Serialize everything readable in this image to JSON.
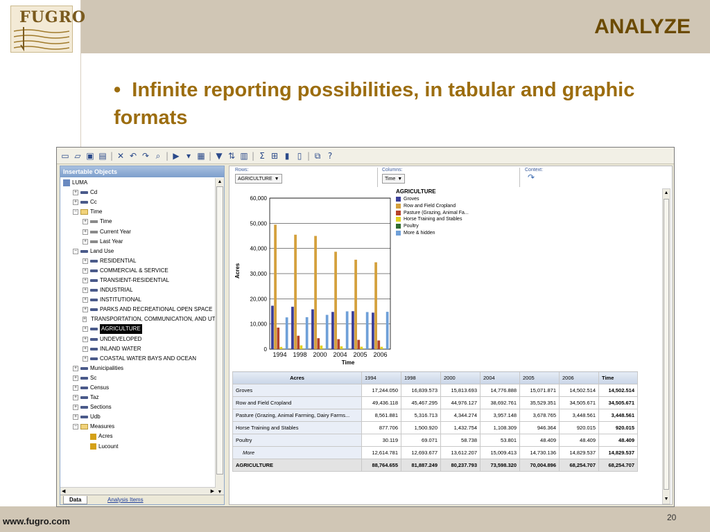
{
  "slide": {
    "brand": "FUGRO",
    "title": "ANALYZE",
    "bullet": "Infinite reporting possibilities, in tabular and graphic formats",
    "footer_url": "www.fugro.com",
    "page_number": "20",
    "colors": {
      "band": "#d0c6b5",
      "title": "#6b4a00",
      "bullet": "#9c6d0f"
    }
  },
  "toolbar": {
    "icons": [
      "new-icon",
      "open-icon",
      "save-icon",
      "save-as-icon",
      "cut-icon",
      "undo-icon",
      "redo-icon",
      "find-icon",
      "run-icon",
      "dropdown-icon",
      "table-view-icon",
      "filter-icon",
      "sort-icon",
      "layout-icon",
      "totals-icon",
      "export-icon",
      "chart-icon",
      "chart-type-icon",
      "window-icon",
      "help-icon"
    ]
  },
  "panel": {
    "title": "Insertable Objects",
    "tree": [
      {
        "level": 0,
        "exp": "",
        "icon": "cube",
        "label": "LUMA"
      },
      {
        "level": 1,
        "exp": "+",
        "icon": "dim",
        "label": "Cd"
      },
      {
        "level": 1,
        "exp": "+",
        "icon": "dim",
        "label": "Cc"
      },
      {
        "level": 1,
        "exp": "−",
        "icon": "fold",
        "label": "Time"
      },
      {
        "level": 2,
        "exp": "+",
        "icon": "lvl",
        "label": "Time"
      },
      {
        "level": 2,
        "exp": "+",
        "icon": "lvl",
        "label": "Current Year"
      },
      {
        "level": 2,
        "exp": "+",
        "icon": "lvl",
        "label": "Last Year"
      },
      {
        "level": 1,
        "exp": "−",
        "icon": "dim",
        "label": "Land Use"
      },
      {
        "level": 2,
        "exp": "+",
        "icon": "dim",
        "label": "RESIDENTIAL"
      },
      {
        "level": 2,
        "exp": "+",
        "icon": "dim",
        "label": "COMMERCIAL & SERVICE"
      },
      {
        "level": 2,
        "exp": "+",
        "icon": "dim",
        "label": "TRANSIENT-RESIDENTIAL"
      },
      {
        "level": 2,
        "exp": "+",
        "icon": "dim",
        "label": "INDUSTRIAL"
      },
      {
        "level": 2,
        "exp": "+",
        "icon": "dim",
        "label": "INSTITUTIONAL"
      },
      {
        "level": 2,
        "exp": "+",
        "icon": "dim",
        "label": "PARKS AND RECREATIONAL OPEN SPACE"
      },
      {
        "level": 2,
        "exp": "+",
        "icon": "dim",
        "label": "TRANSPORTATION, COMMUNICATION, AND UTIL"
      },
      {
        "level": 2,
        "exp": "+",
        "icon": "dim",
        "label": "AGRICULTURE",
        "selected": true
      },
      {
        "level": 2,
        "exp": "+",
        "icon": "dim",
        "label": "UNDEVELOPED"
      },
      {
        "level": 2,
        "exp": "+",
        "icon": "dim",
        "label": "INLAND WATER"
      },
      {
        "level": 2,
        "exp": "+",
        "icon": "dim",
        "label": "COASTAL WATER BAYS AND OCEAN"
      },
      {
        "level": 1,
        "exp": "+",
        "icon": "dim",
        "label": "Municipalities"
      },
      {
        "level": 1,
        "exp": "+",
        "icon": "dim",
        "label": "Sc"
      },
      {
        "level": 1,
        "exp": "+",
        "icon": "dim",
        "label": "Census"
      },
      {
        "level": 1,
        "exp": "+",
        "icon": "dim",
        "label": "Taz"
      },
      {
        "level": 1,
        "exp": "+",
        "icon": "dim",
        "label": "Sections"
      },
      {
        "level": 1,
        "exp": "+",
        "icon": "dim",
        "label": "Udb"
      },
      {
        "level": 1,
        "exp": "−",
        "icon": "fold",
        "label": "Measures"
      },
      {
        "level": 2,
        "exp": "",
        "icon": "meas",
        "label": "Acres"
      },
      {
        "level": 2,
        "exp": "",
        "icon": "meas",
        "label": "Lucount"
      }
    ],
    "tabs": {
      "data": "Data",
      "analysis": "Analysis Items"
    }
  },
  "dropzones": {
    "rows_label": "Rows:",
    "rows_value": "AGRICULTURE",
    "columns_label": "Columns:",
    "columns_value": "Time",
    "context_label": "Context:"
  },
  "chart_data": {
    "type": "bar",
    "title": "AGRICULTURE",
    "xlabel": "Time",
    "ylabel": "Acres",
    "categories": [
      "1994",
      "1998",
      "2000",
      "2004",
      "2005",
      "2006"
    ],
    "ylim": [
      0,
      60000
    ],
    "yticks": [
      "0",
      "10,000",
      "20,000",
      "30,000",
      "40,000",
      "50,000",
      "60,000"
    ],
    "grid": true,
    "legend_position": "right",
    "series": [
      {
        "name": "Groves",
        "color": "#3b3f99",
        "values": [
          17244.05,
          16839.573,
          15813.693,
          14776.888,
          15071.871,
          14502.514
        ]
      },
      {
        "name": "Row and Field Cropland",
        "color": "#d4a03c",
        "values": [
          49436.118,
          45467.295,
          44976.127,
          38692.761,
          35529.351,
          34505.671
        ]
      },
      {
        "name": "Pasture (Grazing, Animal Fa...",
        "color": "#b5432a",
        "values": [
          8561.881,
          5316.713,
          4344.274,
          3957.148,
          3678.765,
          3448.561
        ]
      },
      {
        "name": "Horse Training and Stables",
        "color": "#e0d020",
        "values": [
          877.706,
          1500.92,
          1432.754,
          1108.309,
          946.364,
          920.015
        ]
      },
      {
        "name": "Poultry",
        "color": "#2f6b2f",
        "values": [
          30.119,
          69.071,
          58.738,
          53.801,
          48.409,
          48.409
        ]
      },
      {
        "name": "More & hidden",
        "color": "#6fa0d8",
        "values": [
          12614.781,
          12693.677,
          13612.207,
          15009.413,
          14730.136,
          14829.537
        ]
      }
    ]
  },
  "table": {
    "corner": "Acres",
    "columns": [
      "1994",
      "1998",
      "2000",
      "2004",
      "2005",
      "2006"
    ],
    "total_header": "Time",
    "rows": [
      {
        "label": "Groves",
        "values": [
          "17,244.050",
          "16,839.573",
          "15,813.693",
          "14,776.888",
          "15,071.871",
          "14,502.514"
        ],
        "total": "14,502.514"
      },
      {
        "label": "Row and Field Cropland",
        "values": [
          "49,436.118",
          "45,467.295",
          "44,976.127",
          "38,692.761",
          "35,529.351",
          "34,505.671"
        ],
        "total": "34,505.671"
      },
      {
        "label": "Pasture (Grazing, Animal Farming, Dairy Farms...",
        "values": [
          "8,561.881",
          "5,316.713",
          "4,344.274",
          "3,957.148",
          "3,678.765",
          "3,448.561"
        ],
        "total": "3,448.561"
      },
      {
        "label": "Horse Training and Stables",
        "values": [
          "877.706",
          "1,500.920",
          "1,432.754",
          "1,108.309",
          "946.364",
          "920.015"
        ],
        "total": "920.015"
      },
      {
        "label": "Poultry",
        "values": [
          "30.119",
          "69.071",
          "58.738",
          "53.801",
          "48.409",
          "48.409"
        ],
        "total": "48.409"
      },
      {
        "label": "More",
        "more": true,
        "values": [
          "12,614.781",
          "12,693.677",
          "13,612.207",
          "15,009.413",
          "14,730.136",
          "14,829.537"
        ],
        "total": "14,829.537"
      },
      {
        "label": "AGRICULTURE",
        "agg": true,
        "values": [
          "88,764.655",
          "81,887.249",
          "80,237.793",
          "73,598.320",
          "70,004.896",
          "68,254.707"
        ],
        "total": "68,254.707"
      }
    ]
  }
}
